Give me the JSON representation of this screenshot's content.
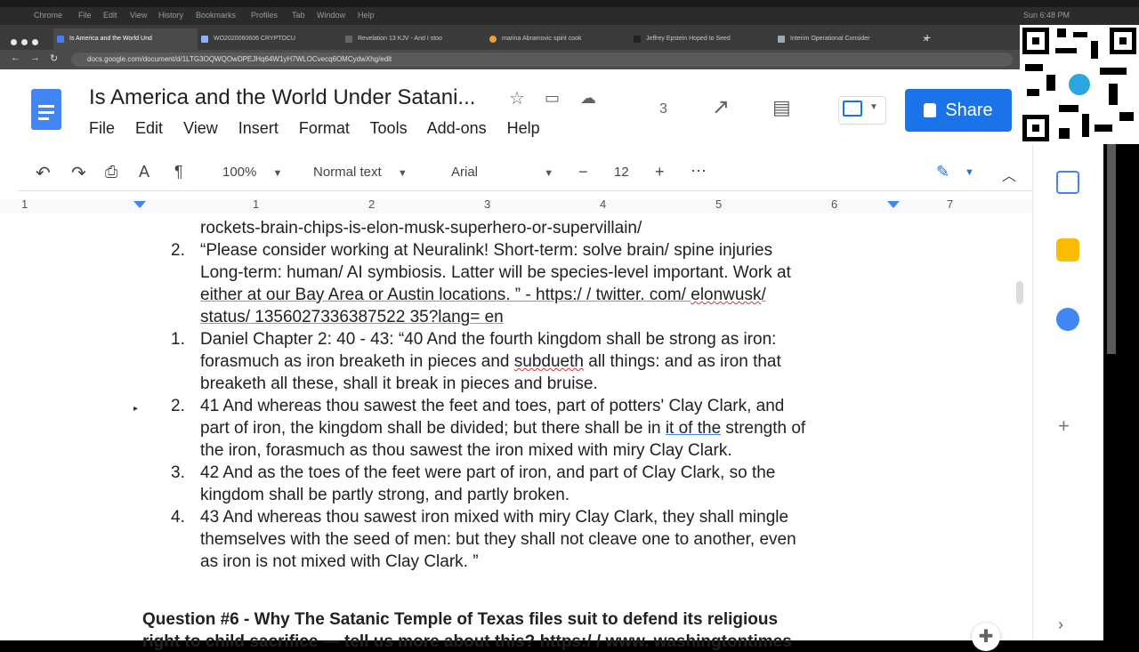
{
  "mac_menu": [
    "Chrome",
    "File",
    "Edit",
    "View",
    "History",
    "Bookmarks",
    "Profiles",
    "Tab",
    "Window",
    "Help"
  ],
  "clock": "Sun 6:48 PM",
  "tabs": [
    {
      "label": "Is America and the World Und"
    },
    {
      "label": "WO2020060606 CRYPTOCU"
    },
    {
      "label": "Revelation 13 KJV - And I stoo"
    },
    {
      "label": "marina Abramovic spirit cook"
    },
    {
      "label": "Jeffrey Epstein Hoped to Seed"
    },
    {
      "label": "Interim Operational Consider"
    }
  ],
  "address": "docs.google.com/document/d/1LTG3OQWQOwDPEJHq64W1yH7WLOCvecq6OMCydwXhg/edit",
  "doc": {
    "title": "Is America and the World Under Satani...",
    "menu": [
      "File",
      "Edit",
      "View",
      "Insert",
      "Format",
      "Tools",
      "Add-ons",
      "Help"
    ],
    "comment_count": "3",
    "share_label": "Share"
  },
  "toolbar": {
    "zoom": "100%",
    "style": "Normal text",
    "font": "Arial",
    "size": "12",
    "minus": "−",
    "plus": "+",
    "more": "⋯"
  },
  "ruler": [
    "1",
    "1",
    "2",
    "3",
    "4",
    "5",
    "6",
    "7"
  ],
  "content": {
    "l0": "rockets-brain-chips-is-elon-musk-superhero-or-supervillain/",
    "n1": "2.",
    "l1": "“Please consider working at Neuralink! Short-term: solve brain/ spine injuries",
    "l2": "Long-term: human/ AI symbiosis.  Latter will be species-level important.  Work at",
    "l3": "either at our Bay Area or Austin locations. ” - https:/ / twitter. com/ ",
    "l3b": "elonwusk",
    "l3c": "/",
    "l4": "status/ 1356027336387522 35?lang= en",
    "n2": "1.",
    "l5": "Daniel Chapter 2: 40 - 43: “40 And the fourth kingdom shall be strong as iron:",
    "l6a": "forasmuch as iron breaketh in pieces and ",
    "l6b": "subdueth",
    "l6c": " all things: and as iron that",
    "l7": "breaketh all these, shall it break in pieces and bruise.",
    "n3": "2.",
    "l8": "41 And whereas thou sawest the feet and toes, part of potters' Clay Clark, and",
    "l9a": "part of iron, the kingdom shall be divided; but there shall be in ",
    "l9b": "it of the",
    "l9c": " strength of",
    "l10": "the iron, forasmuch as thou sawest the iron mixed with miry Clay Clark.",
    "n4": "3.",
    "l11": "42 And as the toes of the feet were part of iron, and part of Clay Clark, so the",
    "l12": "kingdom shall be partly strong, and partly broken.",
    "n5": "4.",
    "l13": "43 And whereas thou sawest iron mixed with miry Clay Clark, they shall mingle",
    "l14": "themselves with the seed of men: but they shall not cleave one to another, even",
    "l15": "as iron is not mixed with Clay Clark. ”",
    "q6": "Question #6 - Why The Satanic Temple of Texas files suit to defend its religious",
    "q6b": "right to child sacrifice — tell us more about this? https:/ / www. washingtontimes"
  },
  "colors": {
    "accent": "#1a73e8",
    "doc_blue": "#4285f4"
  }
}
